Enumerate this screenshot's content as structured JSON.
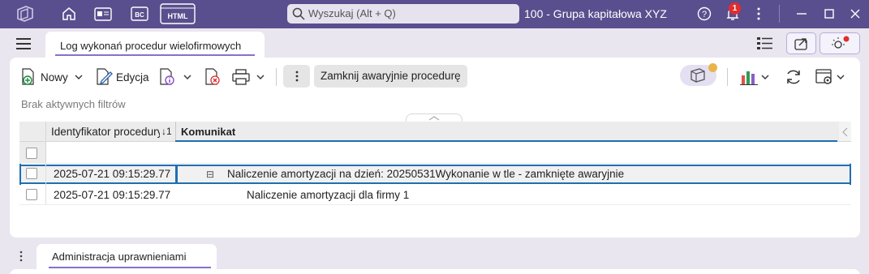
{
  "titlebar": {
    "search_placeholder": "Wyszukaj (Alt + Q)",
    "company": "100 - Grupa kapitałowa XYZ",
    "notification_count": "1",
    "icons": [
      "app-logo-icon",
      "home-icon",
      "id-card-icon",
      "bc-icon",
      "html-icon",
      "search-icon",
      "help-icon",
      "bell-icon",
      "more-icon",
      "minimize-icon",
      "maximize-icon",
      "close-icon"
    ],
    "bc_text": "BC",
    "html_text": "HTML"
  },
  "tabs": {
    "main_tab_label": "Log wykonań procedur wielofirmowych",
    "bottom_tab_label": "Administracja uprawnieniami"
  },
  "toolbar": {
    "new_label": "Nowy",
    "edit_label": "Edycja",
    "emergency_close_label": "Zamknij awaryjnie procedurę"
  },
  "filters_text": "Brak aktywnych filtrów",
  "grid": {
    "columns": [
      {
        "label": "Identyfikator procedury",
        "sort": "↓1"
      },
      {
        "label": "Komunikat"
      }
    ],
    "rows": [
      {
        "id": "2025-07-21 09:15:29.77",
        "message": "Naliczenie amortyzacji na dzień: 20250531Wykonanie w tle - zamknięte awaryjnie",
        "expand": "⊟",
        "selected": true
      },
      {
        "id": "2025-07-21 09:15:29.77",
        "message": "Naliczenie amortyzacji dla firmy 1",
        "selected": false
      }
    ]
  },
  "colors": {
    "titlebar": "#5a4f8e",
    "accent": "#1f6fb2",
    "badge": "#e22d2d",
    "underline": "#8a6fc7"
  }
}
